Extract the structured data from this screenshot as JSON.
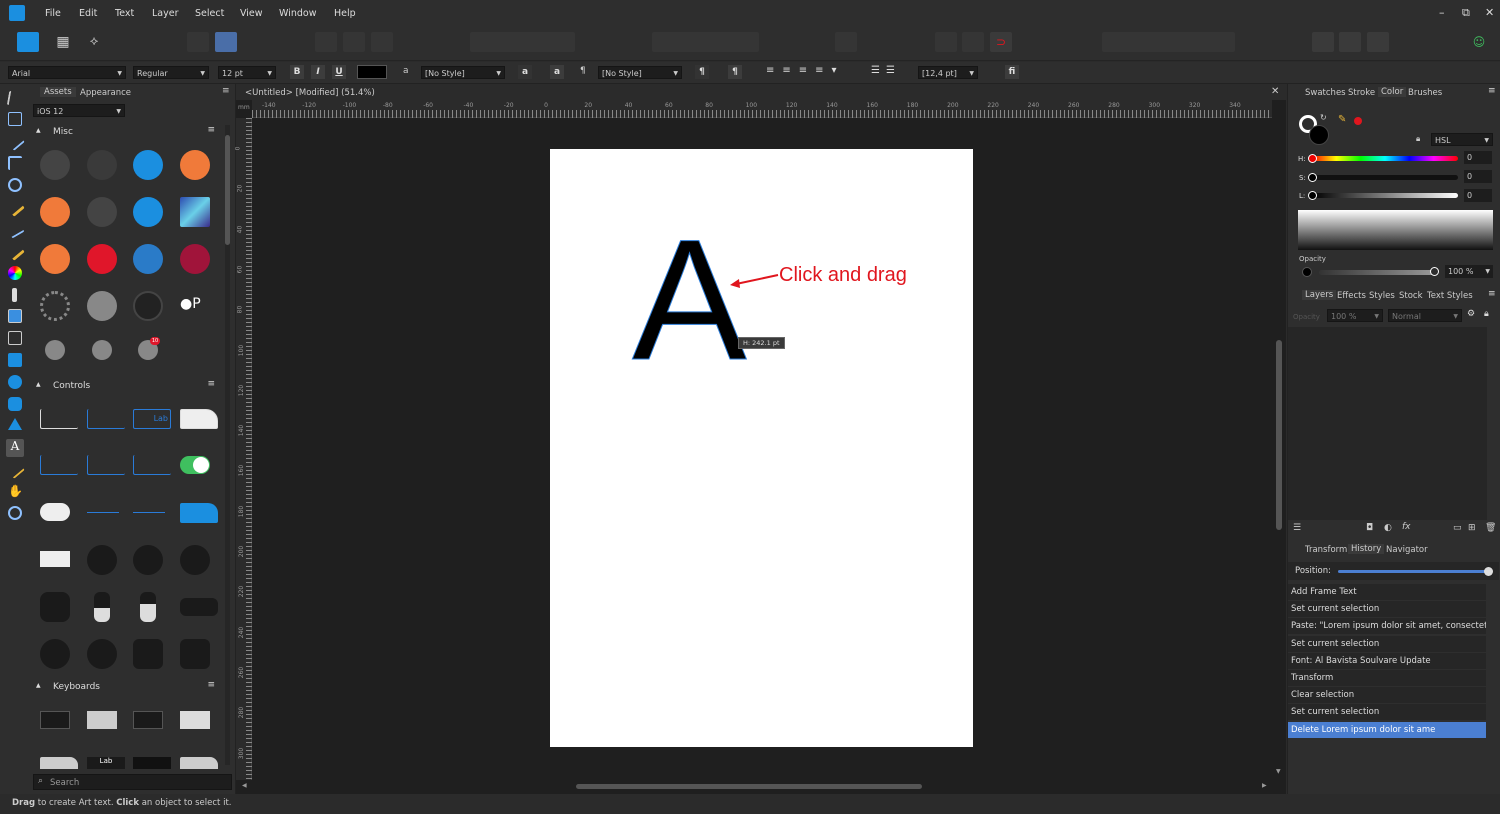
{
  "menu": [
    "File",
    "Edit",
    "Text",
    "Layer",
    "Select",
    "View",
    "Window",
    "Help"
  ],
  "window_controls": [
    "–",
    "⧉",
    "✕"
  ],
  "context": {
    "font": "Arial",
    "style": "Regular",
    "size": "12 pt",
    "bold": "B",
    "italic": "I",
    "underline": "U",
    "char_style": "[No Style]",
    "para_style": "[No Style]",
    "leading": "[12,4 pt]",
    "case_a": "a",
    "pilcrow": "¶",
    "fi": "fi"
  },
  "assets": {
    "tabs": [
      "Assets",
      "Appearance"
    ],
    "category": "iOS 12",
    "sections": [
      "Misc",
      "Controls",
      "Keyboards"
    ],
    "search_placeholder": "Search",
    "badge": "10",
    "label_text": "Lab"
  },
  "document": {
    "tab_title": "<Untitled> [Modified] (51.4%)",
    "ruler_unit": "mm",
    "h_ticks": [
      "-140",
      "-120",
      "-100",
      "-80",
      "-60",
      "-40",
      "-20",
      "0",
      "20",
      "40",
      "60",
      "80",
      "100",
      "120",
      "140",
      "160",
      "180",
      "200",
      "220",
      "240",
      "260",
      "280",
      "300",
      "320",
      "340"
    ],
    "v_ticks": [
      "0",
      "20",
      "40",
      "60",
      "80",
      "100",
      "120",
      "140",
      "160",
      "180",
      "200",
      "220",
      "240",
      "260",
      "280",
      "300"
    ],
    "letter": "A",
    "annotation": "Click and drag",
    "tooltip": "H: 242.1 pt"
  },
  "color_panel": {
    "tabs": [
      "Swatches",
      "Stroke",
      "Color",
      "Brushes"
    ],
    "model": "HSL",
    "h_label": "H:",
    "s_label": "S:",
    "l_label": "L:",
    "h_val": "0",
    "s_val": "0",
    "l_val": "0",
    "opacity_label": "Opacity",
    "opacity_val": "100 %"
  },
  "layers_panel": {
    "tabs": [
      "Layers",
      "Effects",
      "Styles",
      "Stock",
      "Text Styles"
    ],
    "opacity_label": "Opacity",
    "opacity_val": "100 %",
    "blend": "Normal"
  },
  "history_panel": {
    "tabs": [
      "Transform",
      "History",
      "Navigator"
    ],
    "position_label": "Position:",
    "items": [
      "Add Frame Text",
      "Set current selection",
      "Paste: \"Lorem ipsum dolor sit amet, consectet...",
      "Set current selection",
      "Font: Al Bavista Soulvare Update",
      "Transform",
      "Clear selection",
      "Set current selection",
      "Delete Lorem ipsum dolor sit ame"
    ],
    "selected_index": 8
  },
  "status": {
    "drag": "Drag",
    "t1": " to create Art text. ",
    "click": "Click",
    "t2": " an object to select it."
  },
  "colors": {
    "accent": "#2a7bd8",
    "selection": "#4b7fd2",
    "annotation_red": "#e0161e",
    "canvas": "#1f1f1f",
    "panel": "#2e2e2e"
  }
}
